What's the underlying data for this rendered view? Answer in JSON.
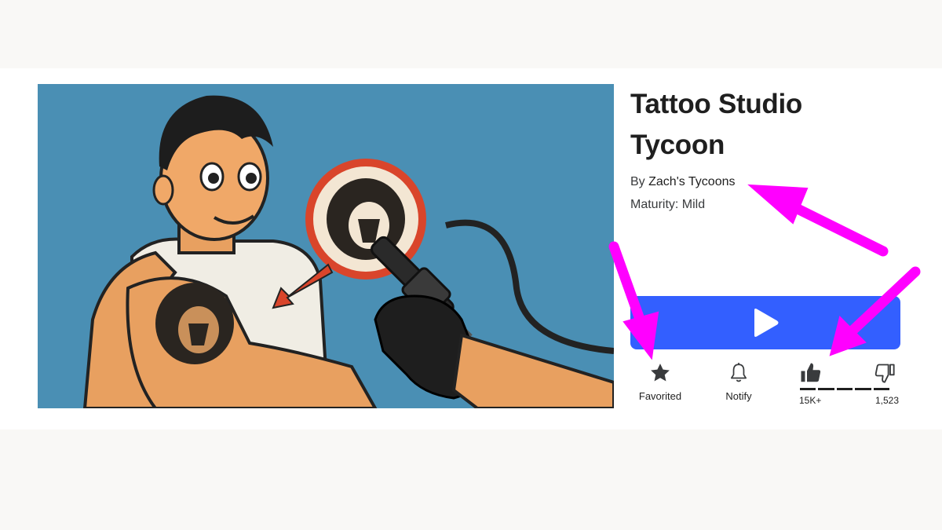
{
  "game": {
    "title_line1": "Tattoo Studio",
    "title_line2": "Tycoon",
    "by_prefix": "By ",
    "creator": "Zach's Tycoons",
    "maturity": "Maturity: Mild"
  },
  "thumbnail": {
    "alt": "Cartoon man with a lion tattoo on his arm and a tattoo machine",
    "background_color": "#4a8fb4"
  },
  "play_button": {
    "icon": "play-icon",
    "color": "#335fff"
  },
  "actions": {
    "favorite_label": "Favorited",
    "favorite_icon": "star-filled-icon",
    "notify_label": "Notify",
    "notify_icon": "bell-icon"
  },
  "votes": {
    "up_count": "15K+",
    "down_count": "1,523",
    "up_icon": "thumbs-up-filled-icon",
    "down_icon": "thumbs-down-outline-icon"
  },
  "annotations": {
    "arrow_color": "#ff00ff",
    "arrow_targets": [
      "creator-link",
      "favorite-button",
      "thumbs-up-button"
    ]
  }
}
